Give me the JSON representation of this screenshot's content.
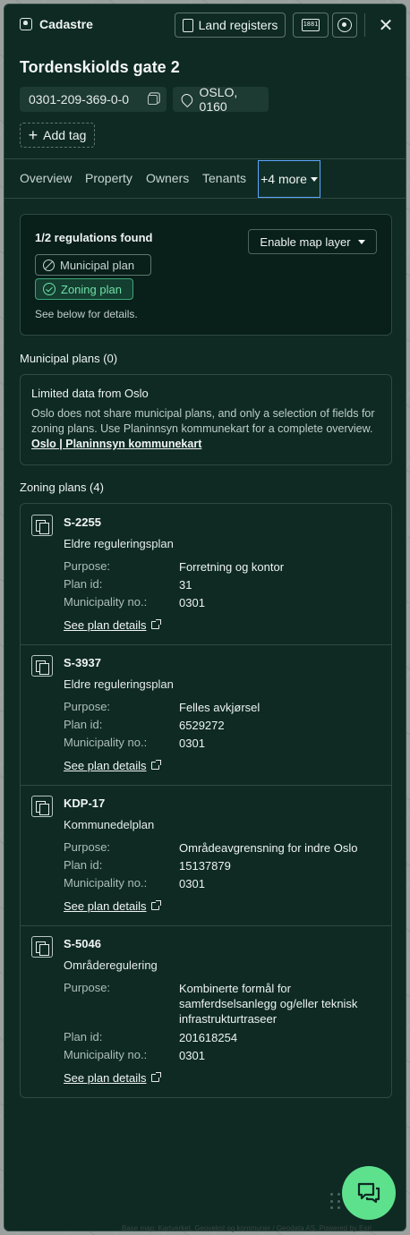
{
  "header": {
    "app_name": "Cadastre",
    "land_registers_label": "Land registers",
    "cad_icon_text": "1881"
  },
  "property": {
    "title": "Tordenskiolds gate 2",
    "id": "0301-209-369-0-0",
    "postal": "OSLO, 0160",
    "add_tag_label": "Add tag"
  },
  "tabs": [
    {
      "label": "Overview"
    },
    {
      "label": "Property"
    },
    {
      "label": "Owners"
    },
    {
      "label": "Tenants"
    },
    {
      "label": "+4 more",
      "active": true
    }
  ],
  "regulations": {
    "found_text": "1/2 regulations found",
    "map_layer_label": "Enable map layer",
    "municipal_badge": "Municipal plan",
    "municipal_found": false,
    "zoning_badge": "Zoning plan",
    "zoning_found": true,
    "note": "See below for details."
  },
  "municipal_section": {
    "heading": "Municipal plans (0)",
    "notice_title": "Limited data from Oslo",
    "notice_text": "Oslo does not share municipal plans, and only a selection of fields for zoning plans. Use Planinnsyn kommunekart for a complete overview.",
    "notice_link": "Oslo | Planinnsyn kommunekart"
  },
  "zoning_section": {
    "heading": "Zoning plans (4)",
    "field_labels": {
      "purpose": "Purpose:",
      "plan_id": "Plan id:",
      "municipality": "Municipality no.:"
    },
    "details_link": "See plan details",
    "plans": [
      {
        "code": "S-2255",
        "type": "Eldre reguleringsplan",
        "purpose": "Forretning og kontor",
        "plan_id": "31",
        "municipality": "0301"
      },
      {
        "code": "S-3937",
        "type": "Eldre reguleringsplan",
        "purpose": "Felles avkjørsel",
        "plan_id": "6529272",
        "municipality": "0301"
      },
      {
        "code": "KDP-17",
        "type": "Kommunedelplan",
        "purpose": "Områdeavgrensning for indre Oslo",
        "plan_id": "15137879",
        "municipality": "0301"
      },
      {
        "code": "S-5046",
        "type": "Områderegulering",
        "purpose": "Kombinerte formål for samferdselsanlegg og/eller teknisk infrastrukturtraseer",
        "plan_id": "201618254",
        "municipality": "0301"
      }
    ]
  },
  "map_attribution": "Base map: Kartverket, Geovekst og kommuner / Geodata AS. Powered by Esri",
  "colors": {
    "panel": "#0e2a23",
    "accent_green": "#5ee18d",
    "focus_blue": "#5ea6ff"
  }
}
